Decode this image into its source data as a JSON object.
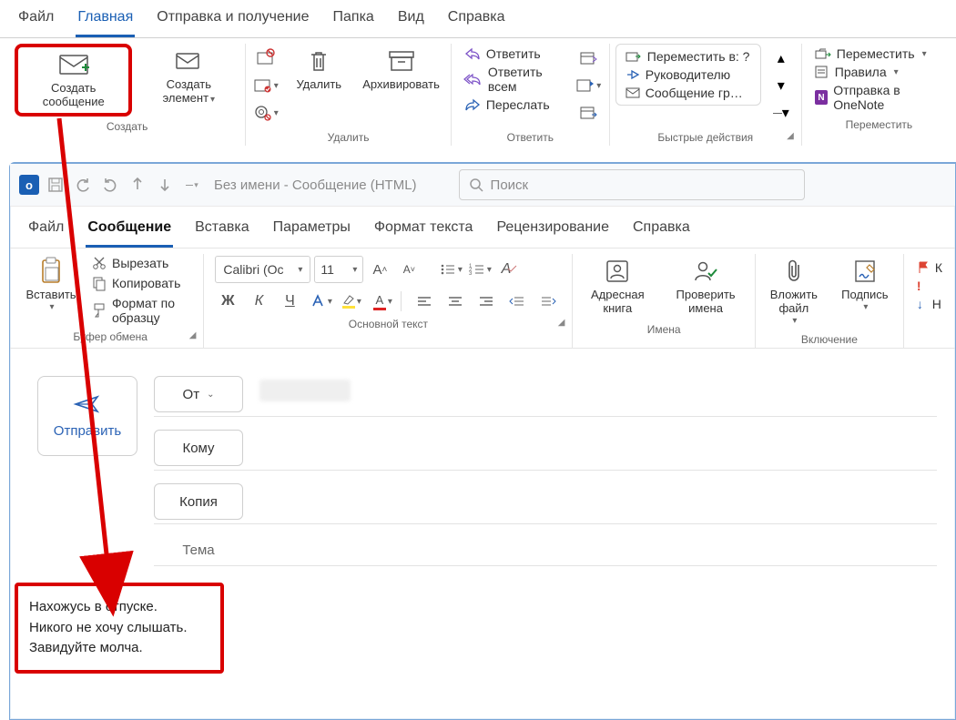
{
  "top": {
    "tabs": [
      "Файл",
      "Главная",
      "Отправка и получение",
      "Папка",
      "Вид",
      "Справка"
    ],
    "active_tab": "Главная",
    "groups": {
      "create": {
        "label": "Создать",
        "new_msg": "Создать сообщение",
        "new_item": "Создать элемент"
      },
      "delete": {
        "label": "Удалить",
        "delete": "Удалить",
        "archive": "Архивировать"
      },
      "reply": {
        "label": "Ответить",
        "reply": "Ответить",
        "reply_all": "Ответить всем",
        "forward": "Переслать"
      },
      "quick": {
        "label": "Быстрые действия",
        "move_to": "Переместить в: ?",
        "to_manager": "Руководителю",
        "team_email": "Сообщение гр…"
      },
      "move": {
        "label": "Переместить",
        "move": "Переместить",
        "rules": "Правила",
        "onenote": "Отправка в OneNote"
      }
    }
  },
  "child": {
    "window_title": "Без имени  -  Сообщение (HTML)",
    "search_placeholder": "Поиск",
    "tabs": [
      "Файл",
      "Сообщение",
      "Вставка",
      "Параметры",
      "Формат текста",
      "Рецензирование",
      "Справка"
    ],
    "active_tab": "Сообщение",
    "clipboard": {
      "paste": "Вставить",
      "cut": "Вырезать",
      "copy": "Копировать",
      "painter": "Формат по образцу",
      "label": "Буфер обмена"
    },
    "font": {
      "name": "Calibri (Ос",
      "size": "11",
      "label": "Основной текст"
    },
    "names": {
      "addr_book": "Адресная книга",
      "check_names": "Проверить имена",
      "label": "Имена"
    },
    "include": {
      "attach": "Вложить файл",
      "signature": "Подпись",
      "label": "Включение"
    },
    "tags": {
      "followup": "К",
      "high": "!",
      "low": "↓",
      "label": ""
    },
    "compose": {
      "send": "Отправить",
      "from": "От",
      "to": "Кому",
      "cc": "Копия",
      "subject": "Тема"
    },
    "body_lines": [
      "Нахожусь в отпуске.",
      "Никого не хочу слышать.",
      "Завидуйте молча."
    ]
  }
}
